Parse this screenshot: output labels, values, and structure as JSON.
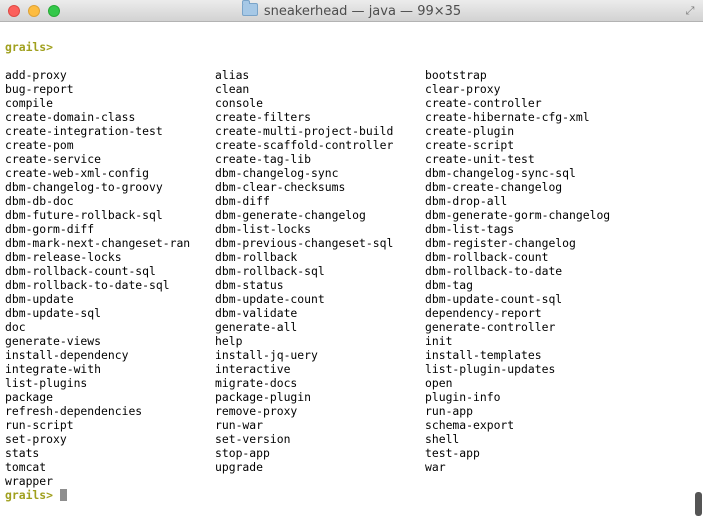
{
  "window": {
    "title": "sneakerhead — java — 99×35"
  },
  "terminal": {
    "prompt": "grails>",
    "commands": [
      "add-proxy",
      "alias",
      "bootstrap",
      "bug-report",
      "clean",
      "clear-proxy",
      "compile",
      "console",
      "create-controller",
      "create-domain-class",
      "create-filters",
      "create-hibernate-cfg-xml",
      "create-integration-test",
      "create-multi-project-build",
      "create-plugin",
      "create-pom",
      "create-scaffold-controller",
      "create-script",
      "create-service",
      "create-tag-lib",
      "create-unit-test",
      "create-web-xml-config",
      "dbm-changelog-sync",
      "dbm-changelog-sync-sql",
      "dbm-changelog-to-groovy",
      "dbm-clear-checksums",
      "dbm-create-changelog",
      "dbm-db-doc",
      "dbm-diff",
      "dbm-drop-all",
      "dbm-future-rollback-sql",
      "dbm-generate-changelog",
      "dbm-generate-gorm-changelog",
      "dbm-gorm-diff",
      "dbm-list-locks",
      "dbm-list-tags",
      "dbm-mark-next-changeset-ran",
      "dbm-previous-changeset-sql",
      "dbm-register-changelog",
      "dbm-release-locks",
      "dbm-rollback",
      "dbm-rollback-count",
      "dbm-rollback-count-sql",
      "dbm-rollback-sql",
      "dbm-rollback-to-date",
      "dbm-rollback-to-date-sql",
      "dbm-status",
      "dbm-tag",
      "dbm-update",
      "dbm-update-count",
      "dbm-update-count-sql",
      "dbm-update-sql",
      "dbm-validate",
      "dependency-report",
      "doc",
      "generate-all",
      "generate-controller",
      "generate-views",
      "help",
      "init",
      "install-dependency",
      "install-jq-uery",
      "install-templates",
      "integrate-with",
      "interactive",
      "list-plugin-updates",
      "list-plugins",
      "migrate-docs",
      "open",
      "package",
      "package-plugin",
      "plugin-info",
      "refresh-dependencies",
      "remove-proxy",
      "run-app",
      "run-script",
      "run-war",
      "schema-export",
      "set-proxy",
      "set-version",
      "shell",
      "stats",
      "stop-app",
      "test-app",
      "tomcat",
      "upgrade",
      "war",
      "wrapper"
    ]
  }
}
